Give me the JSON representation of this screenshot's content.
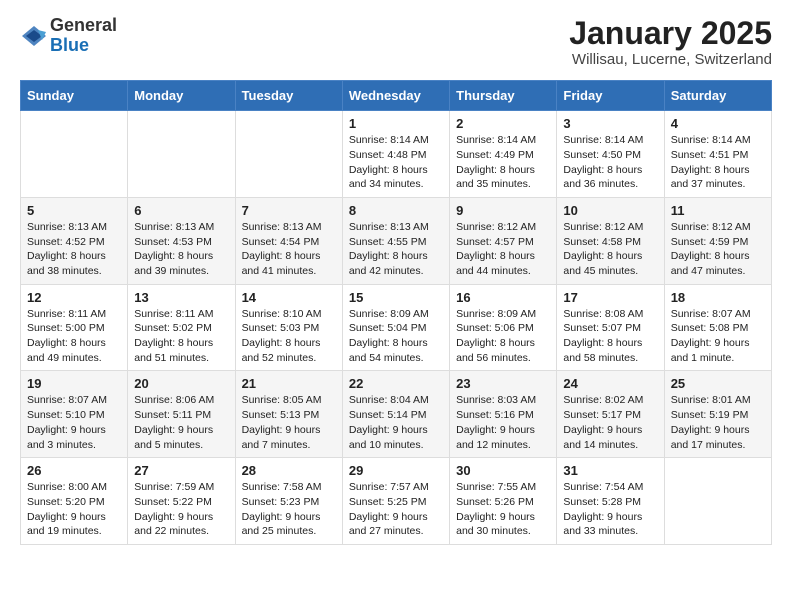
{
  "logo": {
    "general": "General",
    "blue": "Blue"
  },
  "header": {
    "month": "January 2025",
    "location": "Willisau, Lucerne, Switzerland"
  },
  "weekdays": [
    "Sunday",
    "Monday",
    "Tuesday",
    "Wednesday",
    "Thursday",
    "Friday",
    "Saturday"
  ],
  "weeks": [
    [
      {
        "day": "",
        "sunrise": "",
        "sunset": "",
        "daylight": ""
      },
      {
        "day": "",
        "sunrise": "",
        "sunset": "",
        "daylight": ""
      },
      {
        "day": "",
        "sunrise": "",
        "sunset": "",
        "daylight": ""
      },
      {
        "day": "1",
        "sunrise": "Sunrise: 8:14 AM",
        "sunset": "Sunset: 4:48 PM",
        "daylight": "Daylight: 8 hours and 34 minutes."
      },
      {
        "day": "2",
        "sunrise": "Sunrise: 8:14 AM",
        "sunset": "Sunset: 4:49 PM",
        "daylight": "Daylight: 8 hours and 35 minutes."
      },
      {
        "day": "3",
        "sunrise": "Sunrise: 8:14 AM",
        "sunset": "Sunset: 4:50 PM",
        "daylight": "Daylight: 8 hours and 36 minutes."
      },
      {
        "day": "4",
        "sunrise": "Sunrise: 8:14 AM",
        "sunset": "Sunset: 4:51 PM",
        "daylight": "Daylight: 8 hours and 37 minutes."
      }
    ],
    [
      {
        "day": "5",
        "sunrise": "Sunrise: 8:13 AM",
        "sunset": "Sunset: 4:52 PM",
        "daylight": "Daylight: 8 hours and 38 minutes."
      },
      {
        "day": "6",
        "sunrise": "Sunrise: 8:13 AM",
        "sunset": "Sunset: 4:53 PM",
        "daylight": "Daylight: 8 hours and 39 minutes."
      },
      {
        "day": "7",
        "sunrise": "Sunrise: 8:13 AM",
        "sunset": "Sunset: 4:54 PM",
        "daylight": "Daylight: 8 hours and 41 minutes."
      },
      {
        "day": "8",
        "sunrise": "Sunrise: 8:13 AM",
        "sunset": "Sunset: 4:55 PM",
        "daylight": "Daylight: 8 hours and 42 minutes."
      },
      {
        "day": "9",
        "sunrise": "Sunrise: 8:12 AM",
        "sunset": "Sunset: 4:57 PM",
        "daylight": "Daylight: 8 hours and 44 minutes."
      },
      {
        "day": "10",
        "sunrise": "Sunrise: 8:12 AM",
        "sunset": "Sunset: 4:58 PM",
        "daylight": "Daylight: 8 hours and 45 minutes."
      },
      {
        "day": "11",
        "sunrise": "Sunrise: 8:12 AM",
        "sunset": "Sunset: 4:59 PM",
        "daylight": "Daylight: 8 hours and 47 minutes."
      }
    ],
    [
      {
        "day": "12",
        "sunrise": "Sunrise: 8:11 AM",
        "sunset": "Sunset: 5:00 PM",
        "daylight": "Daylight: 8 hours and 49 minutes."
      },
      {
        "day": "13",
        "sunrise": "Sunrise: 8:11 AM",
        "sunset": "Sunset: 5:02 PM",
        "daylight": "Daylight: 8 hours and 51 minutes."
      },
      {
        "day": "14",
        "sunrise": "Sunrise: 8:10 AM",
        "sunset": "Sunset: 5:03 PM",
        "daylight": "Daylight: 8 hours and 52 minutes."
      },
      {
        "day": "15",
        "sunrise": "Sunrise: 8:09 AM",
        "sunset": "Sunset: 5:04 PM",
        "daylight": "Daylight: 8 hours and 54 minutes."
      },
      {
        "day": "16",
        "sunrise": "Sunrise: 8:09 AM",
        "sunset": "Sunset: 5:06 PM",
        "daylight": "Daylight: 8 hours and 56 minutes."
      },
      {
        "day": "17",
        "sunrise": "Sunrise: 8:08 AM",
        "sunset": "Sunset: 5:07 PM",
        "daylight": "Daylight: 8 hours and 58 minutes."
      },
      {
        "day": "18",
        "sunrise": "Sunrise: 8:07 AM",
        "sunset": "Sunset: 5:08 PM",
        "daylight": "Daylight: 9 hours and 1 minute."
      }
    ],
    [
      {
        "day": "19",
        "sunrise": "Sunrise: 8:07 AM",
        "sunset": "Sunset: 5:10 PM",
        "daylight": "Daylight: 9 hours and 3 minutes."
      },
      {
        "day": "20",
        "sunrise": "Sunrise: 8:06 AM",
        "sunset": "Sunset: 5:11 PM",
        "daylight": "Daylight: 9 hours and 5 minutes."
      },
      {
        "day": "21",
        "sunrise": "Sunrise: 8:05 AM",
        "sunset": "Sunset: 5:13 PM",
        "daylight": "Daylight: 9 hours and 7 minutes."
      },
      {
        "day": "22",
        "sunrise": "Sunrise: 8:04 AM",
        "sunset": "Sunset: 5:14 PM",
        "daylight": "Daylight: 9 hours and 10 minutes."
      },
      {
        "day": "23",
        "sunrise": "Sunrise: 8:03 AM",
        "sunset": "Sunset: 5:16 PM",
        "daylight": "Daylight: 9 hours and 12 minutes."
      },
      {
        "day": "24",
        "sunrise": "Sunrise: 8:02 AM",
        "sunset": "Sunset: 5:17 PM",
        "daylight": "Daylight: 9 hours and 14 minutes."
      },
      {
        "day": "25",
        "sunrise": "Sunrise: 8:01 AM",
        "sunset": "Sunset: 5:19 PM",
        "daylight": "Daylight: 9 hours and 17 minutes."
      }
    ],
    [
      {
        "day": "26",
        "sunrise": "Sunrise: 8:00 AM",
        "sunset": "Sunset: 5:20 PM",
        "daylight": "Daylight: 9 hours and 19 minutes."
      },
      {
        "day": "27",
        "sunrise": "Sunrise: 7:59 AM",
        "sunset": "Sunset: 5:22 PM",
        "daylight": "Daylight: 9 hours and 22 minutes."
      },
      {
        "day": "28",
        "sunrise": "Sunrise: 7:58 AM",
        "sunset": "Sunset: 5:23 PM",
        "daylight": "Daylight: 9 hours and 25 minutes."
      },
      {
        "day": "29",
        "sunrise": "Sunrise: 7:57 AM",
        "sunset": "Sunset: 5:25 PM",
        "daylight": "Daylight: 9 hours and 27 minutes."
      },
      {
        "day": "30",
        "sunrise": "Sunrise: 7:55 AM",
        "sunset": "Sunset: 5:26 PM",
        "daylight": "Daylight: 9 hours and 30 minutes."
      },
      {
        "day": "31",
        "sunrise": "Sunrise: 7:54 AM",
        "sunset": "Sunset: 5:28 PM",
        "daylight": "Daylight: 9 hours and 33 minutes."
      },
      {
        "day": "",
        "sunrise": "",
        "sunset": "",
        "daylight": ""
      }
    ]
  ]
}
